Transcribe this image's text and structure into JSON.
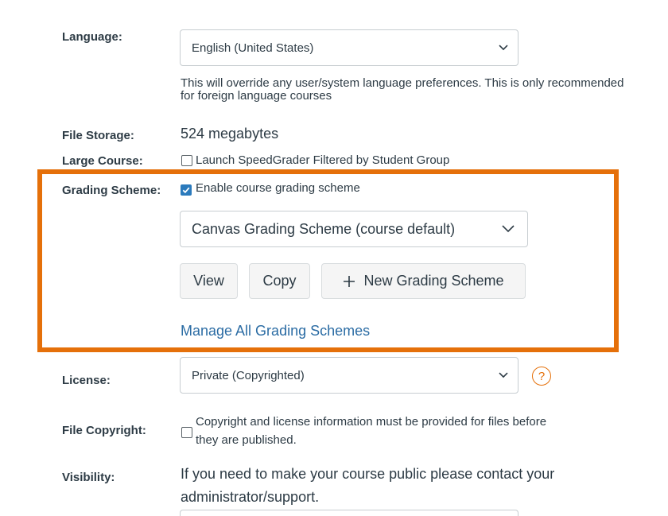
{
  "language": {
    "label": "Language:",
    "value": "English (United States)",
    "help": "This will override any user/system language preferences. This is only recommended for foreign language courses"
  },
  "file_storage": {
    "label": "File Storage:",
    "value": "524 megabytes"
  },
  "large_course": {
    "label": "Large Course:",
    "checkbox_label": "Launch SpeedGrader Filtered by Student Group",
    "checked": false
  },
  "grading_scheme": {
    "label": "Grading Scheme:",
    "checkbox_label": "Enable course grading scheme",
    "checked": true,
    "selected": "Canvas Grading Scheme (course default)",
    "view_label": "View",
    "copy_label": "Copy",
    "new_label": "New Grading Scheme",
    "manage_link": "Manage All Grading Schemes",
    "highlight_color": "#e5700a"
  },
  "license": {
    "label": "License:",
    "value": "Private (Copyrighted)",
    "help_icon": "?"
  },
  "file_copyright": {
    "label": "File Copyright:",
    "line1": "Copyright and license information must be provided for files before",
    "line2": "they are published.",
    "checked": false
  },
  "visibility": {
    "label": "Visibility:",
    "line1": "If you need to make your course public please contact your",
    "line2": "administrator/support."
  }
}
